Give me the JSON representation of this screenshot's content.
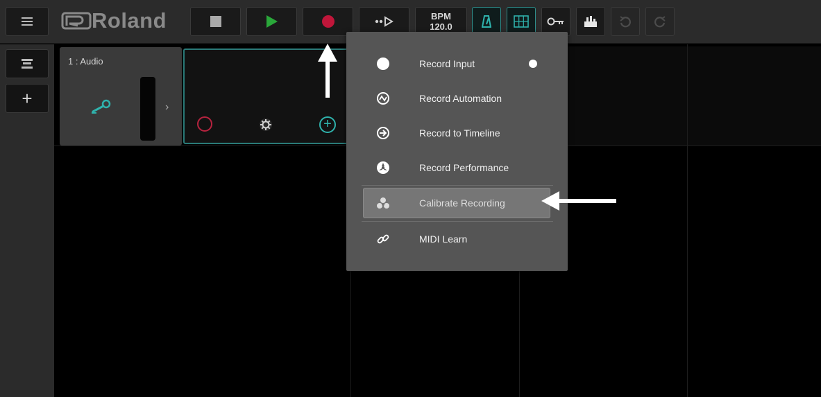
{
  "app": {
    "brand": "Roland",
    "accent_color": "#2fb3ad",
    "record_color": "#c0163a",
    "play_color": "#2aa83a"
  },
  "toolbar": {
    "menu_icon": "hamburger-menu-icon",
    "stop_icon": "stop-icon",
    "play_icon": "play-icon",
    "record_icon": "record-icon",
    "loop_icon": "loop-play-icon",
    "bpm_label": "BPM",
    "bpm_value": "120.0",
    "metronome_icon": "metronome-icon",
    "grid_icon": "grid-icon",
    "key_icon": "key-icon",
    "mixer_icon": "mixer-icon",
    "undo_icon": "undo-icon",
    "redo_icon": "redo-icon"
  },
  "sidebar": {
    "tracks_icon": "tracks-icon",
    "add_icon": "plus-icon"
  },
  "track": {
    "name": "1 : Audio",
    "icon": "microphone-icon"
  },
  "record_menu": {
    "items": [
      {
        "label": "Record Input",
        "icon": "filled-circle-icon",
        "enabled": true
      },
      {
        "label": "Record Automation",
        "icon": "automation-icon",
        "enabled": false
      },
      {
        "label": "Record to Timeline",
        "icon": "arrow-right-circle-icon",
        "enabled": false
      },
      {
        "label": "Record Performance",
        "icon": "performance-icon",
        "enabled": false
      },
      {
        "label": "Calibrate Recording",
        "icon": "calibrate-icon",
        "highlighted": true
      },
      {
        "label": "MIDI Learn",
        "icon": "link-icon",
        "enabled": false
      }
    ]
  }
}
